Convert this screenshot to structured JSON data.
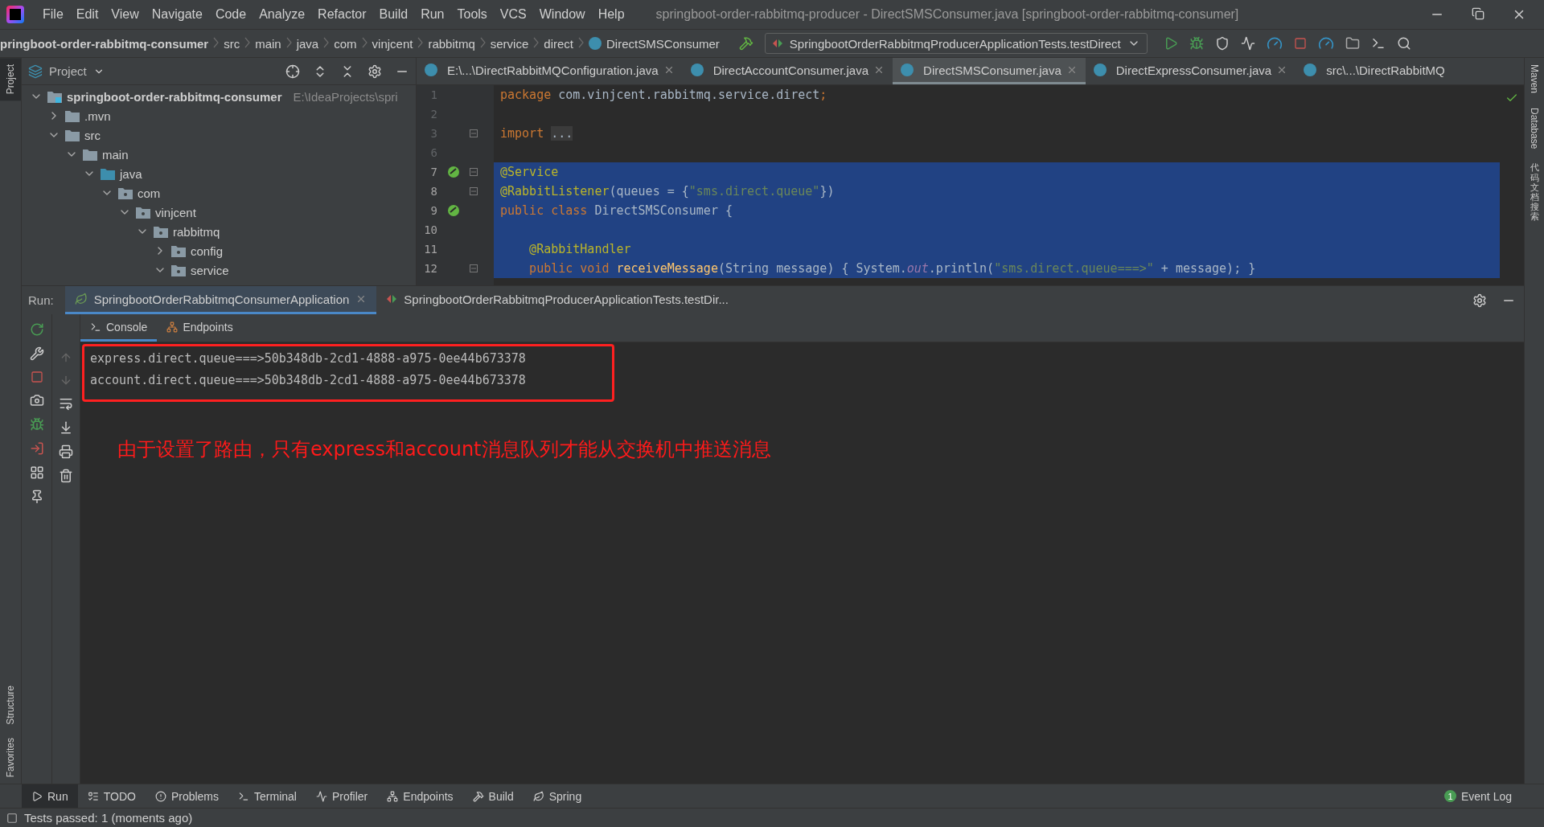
{
  "menu": [
    "File",
    "Edit",
    "View",
    "Navigate",
    "Code",
    "Analyze",
    "Refactor",
    "Build",
    "Run",
    "Tools",
    "VCS",
    "Window",
    "Help"
  ],
  "window": {
    "title": "springboot-order-rabbitmq-producer - DirectSMSConsumer.java [springboot-order-rabbitmq-consumer]"
  },
  "breadcrumbs": [
    "pringboot-order-rabbitmq-consumer",
    "src",
    "main",
    "java",
    "com",
    "vinjcent",
    "rabbitmq",
    "service",
    "direct",
    "DirectSMSConsumer"
  ],
  "run_config": "SpringbootOrderRabbitmqProducerApplicationTests.testDirect",
  "left_strip": [
    {
      "label": "Project",
      "selected": true
    },
    {
      "label": "Structure",
      "selected": false
    },
    {
      "label": "Favorites",
      "selected": false
    }
  ],
  "right_strip": [
    "Maven",
    "Database",
    "代码文档搜索"
  ],
  "project_panel": {
    "title": "Project",
    "tree": [
      {
        "name": "springboot-order-rabbitmq-consumer",
        "hint": "E:\\IdeaProjects\\spri",
        "kind": "module",
        "expanded": true,
        "children": [
          {
            "name": ".mvn",
            "kind": "folder",
            "expanded": false
          },
          {
            "name": "src",
            "kind": "folder",
            "expanded": true,
            "children": [
              {
                "name": "main",
                "kind": "folder",
                "expanded": true,
                "children": [
                  {
                    "name": "java",
                    "kind": "source",
                    "expanded": true,
                    "children": [
                      {
                        "name": "com",
                        "kind": "package",
                        "expanded": true,
                        "children": [
                          {
                            "name": "vinjcent",
                            "kind": "package",
                            "expanded": true,
                            "children": [
                              {
                                "name": "rabbitmq",
                                "kind": "package",
                                "expanded": true,
                                "children": [
                                  {
                                    "name": "config",
                                    "kind": "package",
                                    "expanded": false
                                  },
                                  {
                                    "name": "service",
                                    "kind": "package",
                                    "expanded": true
                                  }
                                ]
                              }
                            ]
                          }
                        ]
                      }
                    ]
                  }
                ]
              }
            ]
          }
        ]
      }
    ]
  },
  "editor": {
    "tabs": [
      {
        "label": "E:\\...\\DirectRabbitMQConfiguration.java",
        "selected": false,
        "closable": true
      },
      {
        "label": "DirectAccountConsumer.java",
        "selected": false,
        "closable": true
      },
      {
        "label": "DirectSMSConsumer.java",
        "selected": true,
        "closable": true
      },
      {
        "label": "DirectExpressConsumer.java",
        "selected": false,
        "closable": true
      },
      {
        "label": "src\\...\\DirectRabbitMQ",
        "selected": false,
        "closable": false
      }
    ],
    "lines": [
      {
        "number": "1",
        "selected": false,
        "fold": false,
        "bean": false,
        "tokens": [
          {
            "kind": "keyword",
            "text": "package "
          },
          {
            "kind": "plain",
            "text": "com.vinjcent.rabbitmq.service.direct"
          },
          {
            "kind": "keyword",
            "text": ";"
          }
        ]
      },
      {
        "number": "2",
        "selected": false,
        "fold": false,
        "bean": false
      },
      {
        "number": "3",
        "selected": false,
        "fold": true,
        "bean": false,
        "tokens": [
          {
            "kind": "keyword",
            "text": "import "
          },
          {
            "kind": "folded",
            "text": "..."
          }
        ]
      },
      {
        "number": "6",
        "selected": false,
        "fold": false,
        "bean": false
      },
      {
        "number": "7",
        "selected": true,
        "fold": true,
        "bean": true,
        "tokens": [
          {
            "kind": "annotation",
            "text": "@Service"
          }
        ]
      },
      {
        "number": "8",
        "selected": true,
        "fold": true,
        "bean": false,
        "tokens": [
          {
            "kind": "annotation",
            "text": "@RabbitListener"
          },
          {
            "kind": "plain",
            "text": "(queues = {"
          },
          {
            "kind": "string",
            "text": "\"sms.direct.queue\""
          },
          {
            "kind": "plain",
            "text": "})"
          }
        ]
      },
      {
        "number": "9",
        "selected": true,
        "fold": false,
        "bean": true,
        "tokens": [
          {
            "kind": "keyword",
            "text": "public class "
          },
          {
            "kind": "plain",
            "text": "DirectSMSConsumer {"
          }
        ]
      },
      {
        "number": "10",
        "selected": true,
        "fold": false,
        "bean": false
      },
      {
        "number": "11",
        "selected": true,
        "fold": false,
        "bean": false,
        "tokens": [
          {
            "kind": "annotation",
            "text": "    @RabbitHandler"
          }
        ]
      },
      {
        "number": "12",
        "selected": true,
        "fold": true,
        "bean": false,
        "tokens": [
          {
            "kind": "keyword",
            "text": "    public void "
          },
          {
            "kind": "method",
            "text": "receiveMessage"
          },
          {
            "kind": "plain",
            "text": "(String message) { System."
          },
          {
            "kind": "field",
            "text": "out"
          },
          {
            "kind": "plain",
            "text": ".println("
          },
          {
            "kind": "string",
            "text": "\"sms.direct.queue===>\""
          },
          {
            "kind": "plain",
            "text": " + message); }"
          }
        ]
      }
    ]
  },
  "run_panel": {
    "label": "Run:",
    "tabs": [
      {
        "label": "SpringbootOrderRabbitmqConsumerApplication",
        "kind": "app",
        "selected": true
      },
      {
        "label": "SpringbootOrderRabbitmqProducerApplicationTests.testDir...",
        "kind": "test",
        "selected": false
      }
    ],
    "console_tabs": [
      {
        "label": "Console",
        "selected": true
      },
      {
        "label": "Endpoints",
        "selected": false
      }
    ],
    "output": [
      "express.direct.queue===>50b348db-2cd1-4888-a975-0ee44b673378",
      "account.direct.queue===>50b348db-2cd1-4888-a975-0ee44b673378"
    ],
    "annotation": "由于设置了路由，只有express和account消息队列才能从交换机中推送消息"
  },
  "bottom_tools": [
    {
      "label": "Run",
      "selected": true
    },
    {
      "label": "TODO",
      "selected": false
    },
    {
      "label": "Problems",
      "selected": false
    },
    {
      "label": "Terminal",
      "selected": false
    },
    {
      "label": "Profiler",
      "selected": false
    },
    {
      "label": "Endpoints",
      "selected": false
    },
    {
      "label": "Build",
      "selected": false
    },
    {
      "label": "Spring",
      "selected": false
    }
  ],
  "event_log": {
    "label": "Event Log",
    "count": "1"
  },
  "status_bar": "Tests passed: 1 (moments ago)"
}
